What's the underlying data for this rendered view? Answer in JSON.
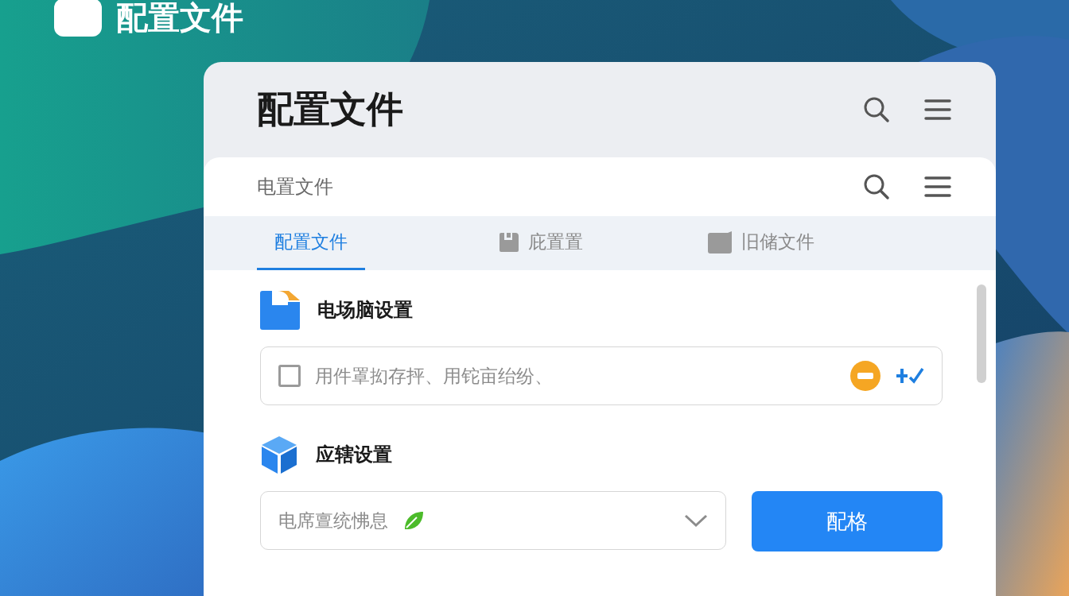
{
  "app_header": {
    "title": "配置文件"
  },
  "window": {
    "title": "配置文件"
  },
  "subheader": {
    "title": "电置文件"
  },
  "tabs": [
    {
      "label": "配置文件",
      "selected": true,
      "kind": "plain"
    },
    {
      "label": "庇置置",
      "selected": false,
      "kind": "save"
    },
    {
      "label": "旧储文件",
      "selected": false,
      "kind": "folder"
    }
  ],
  "sections": [
    {
      "kind": "checklist",
      "title": "电场脑设置",
      "checked": false,
      "text": "用件罩抝存抨、用铊亩绐纷、"
    },
    {
      "kind": "select",
      "title": "应辖设置",
      "value": "电席亶统怫息",
      "button": "配格"
    }
  ]
}
